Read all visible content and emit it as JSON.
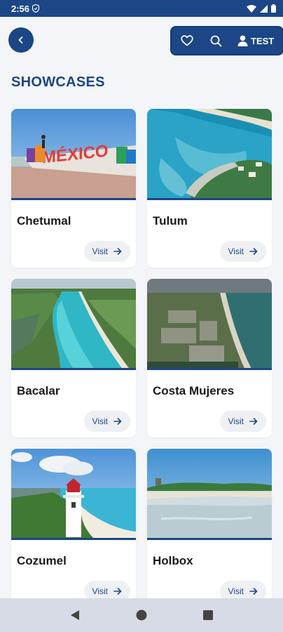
{
  "status_bar": {
    "time": "2:56"
  },
  "header": {
    "user_label": "TEST"
  },
  "section_title": "SHOWCASES",
  "showcases": [
    {
      "name": "Chetumal",
      "visit_label": "Visit"
    },
    {
      "name": "Tulum",
      "visit_label": "Visit"
    },
    {
      "name": "Bacalar",
      "visit_label": "Visit"
    },
    {
      "name": "Costa Mujeres",
      "visit_label": "Visit"
    },
    {
      "name": "Cozumel",
      "visit_label": "Visit"
    },
    {
      "name": "Holbox",
      "visit_label": "Visit"
    }
  ],
  "sign_image_text": "MÉXICO",
  "colors": {
    "primary": "#1c4686",
    "background": "#f3f5f9",
    "chip": "#eef0f4"
  },
  "icons": [
    "shield-icon",
    "wifi-icon",
    "signal-icon",
    "battery-icon",
    "back-arrow-icon",
    "heart-icon",
    "search-icon",
    "user-icon",
    "arrow-right-icon",
    "nav-back-icon",
    "nav-home-icon",
    "nav-recents-icon"
  ]
}
